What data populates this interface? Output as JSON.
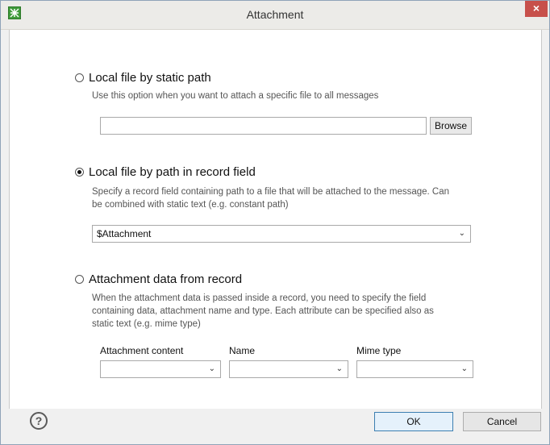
{
  "window": {
    "title": "Attachment",
    "close_label": "×"
  },
  "options": {
    "static_path": {
      "label": "Local file by static path",
      "description": "Use this option when you want to attach a specific file to all messages",
      "path_value": "",
      "browse_label": "Browse",
      "selected": false
    },
    "record_field": {
      "label": "Local file by path in record field",
      "description_line1": "Specify a record field containing path to a file that will be attached to the message. Can",
      "description_line2": "be combined with static text (e.g. constant path)",
      "field_value": "$Attachment",
      "selected": true
    },
    "from_record": {
      "label": "Attachment data from record",
      "description_line1": "When the attachment data is passed inside a record, you need to specify the field",
      "description_line2": "containing data, attachment name and type. Each attribute can be specified also as",
      "description_line3": "static text (e.g. mime type)",
      "content_label": "Attachment content",
      "name_label": "Name",
      "mime_label": "Mime type",
      "content_value": "",
      "name_value": "",
      "mime_value": "",
      "selected": false
    }
  },
  "footer": {
    "help_label": "?",
    "ok_label": "OK",
    "cancel_label": "Cancel"
  },
  "icons": {
    "app": "app-logo-icon",
    "dropdown": "chevron-down-icon",
    "help": "help-icon",
    "close": "close-icon"
  },
  "colors": {
    "close_button": "#c7504b",
    "app_icon": "#3f9a3a"
  }
}
